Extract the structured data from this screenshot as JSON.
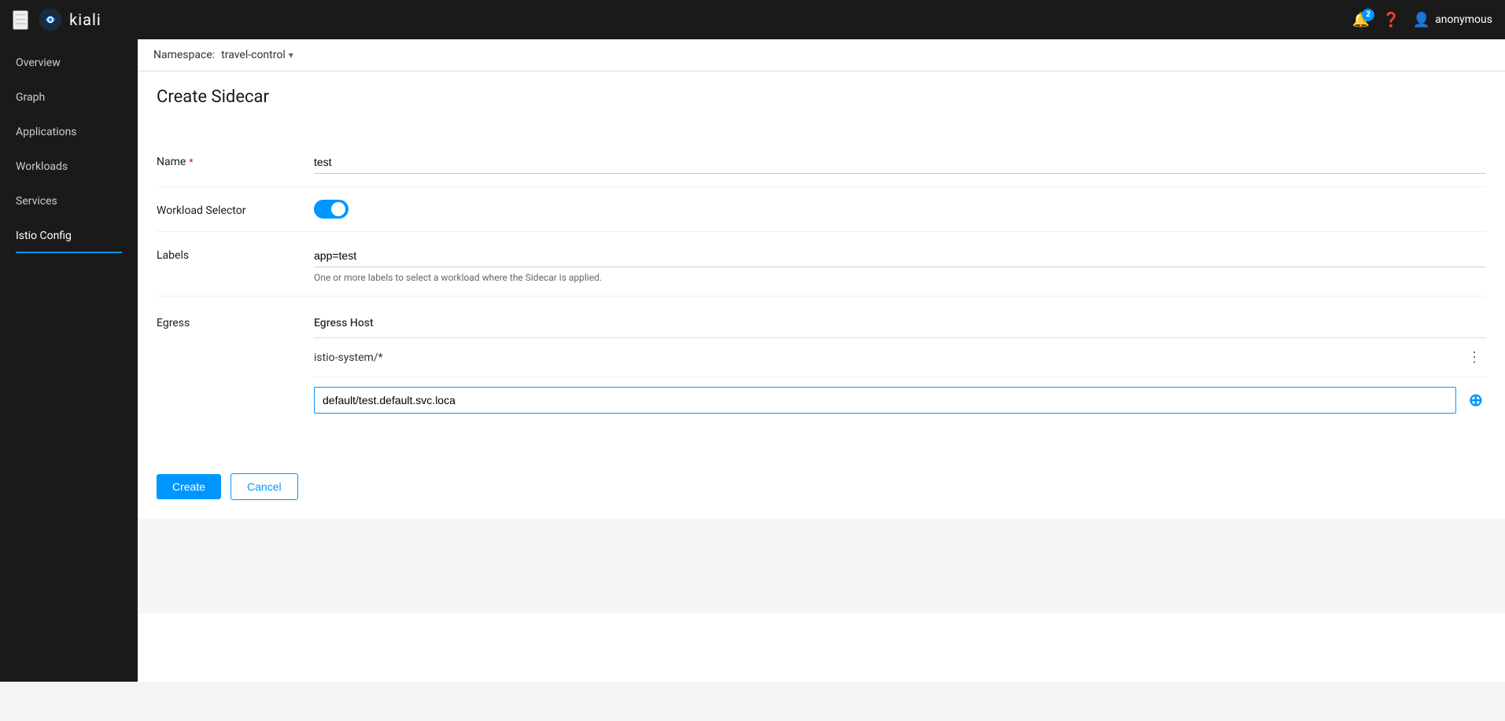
{
  "header": {
    "hamburger_label": "☰",
    "logo_text": "kiali",
    "notification_badge": "2",
    "user_name": "anonymous",
    "help_symbol": "?",
    "bell_symbol": "🔔"
  },
  "sidebar": {
    "items": [
      {
        "id": "overview",
        "label": "Overview",
        "active": false
      },
      {
        "id": "graph",
        "label": "Graph",
        "active": false
      },
      {
        "id": "applications",
        "label": "Applications",
        "active": false
      },
      {
        "id": "workloads",
        "label": "Workloads",
        "active": false
      },
      {
        "id": "services",
        "label": "Services",
        "active": false
      },
      {
        "id": "istio-config",
        "label": "Istio Config",
        "active": true
      }
    ]
  },
  "namespace_bar": {
    "label": "Namespace:",
    "selected": "travel-control"
  },
  "page": {
    "title": "Create Sidecar"
  },
  "form": {
    "name_label": "Name",
    "name_required": "*",
    "name_value": "test",
    "workload_selector_label": "Workload Selector",
    "labels_label": "Labels",
    "labels_value": "app=test",
    "labels_hint": "One or more labels to select a workload where the Sidecar is applied.",
    "egress_label": "Egress",
    "egress_host_header": "Egress Host",
    "egress_item_1": "istio-system/*",
    "egress_input_value": "default/test.default.svc.loca",
    "egress_input_placeholder": ""
  },
  "actions": {
    "create_label": "Create",
    "cancel_label": "Cancel"
  },
  "icons": {
    "dropdown_arrow": "▾",
    "more_dots": "⋮",
    "add_circle": "⊕",
    "circle_plus": "+"
  }
}
